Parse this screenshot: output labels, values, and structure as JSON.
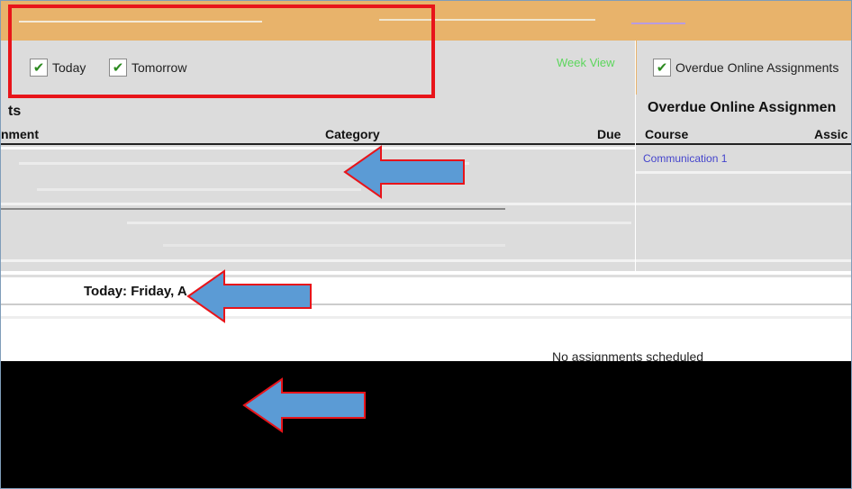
{
  "filters": {
    "today_label": "Today",
    "tomorrow_label": "Tomorrow",
    "week_view_label": "Week View",
    "overdue_label": "Overdue Online Assignments"
  },
  "left_panel": {
    "heading_fragment": "ts",
    "col_assignment": "nment",
    "col_category": "Category",
    "col_due": "Due"
  },
  "right_panel": {
    "heading": "Overdue Online Assignmen",
    "col_course": "Course",
    "col_assignment": "Assic",
    "course_1": "Communication 1"
  },
  "today": {
    "heading": "Today: Friday, A",
    "empty_message": "No assignments scheduled"
  },
  "colors": {
    "accent_orange": "#e8b36b",
    "highlight_red": "#e8141a",
    "arrow_blue": "#5b9bd5",
    "week_view_green": "#5cd65c"
  }
}
